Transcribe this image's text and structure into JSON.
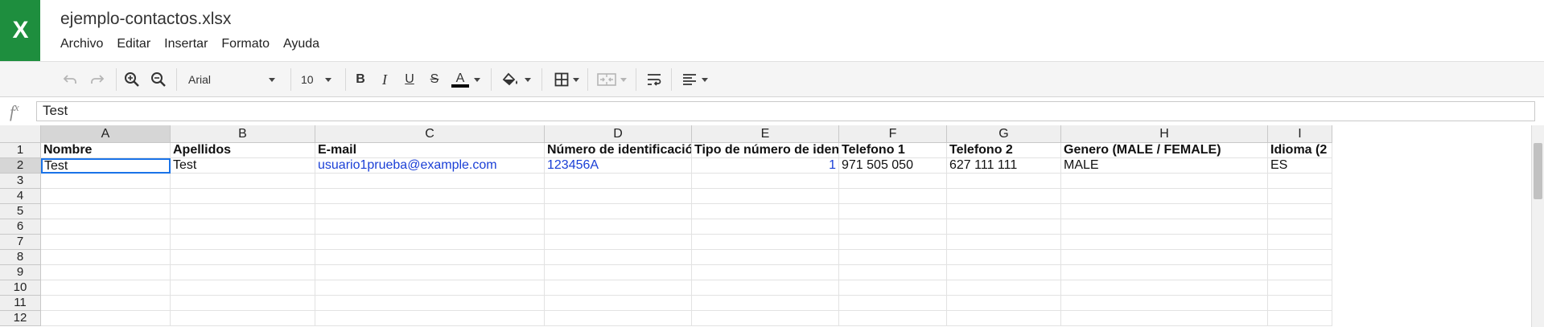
{
  "app": {
    "logo_letter": "X",
    "document_title": "ejemplo-contactos.xlsx",
    "menu": [
      "Archivo",
      "Editar",
      "Insertar",
      "Formato",
      "Ayuda"
    ]
  },
  "toolbar": {
    "font_name": "Arial",
    "font_size": "10",
    "text_color": "#000000",
    "icons": [
      "undo-icon",
      "redo-icon",
      "zoom-in-icon",
      "zoom-out-icon",
      "bold-icon",
      "italic-icon",
      "underline-icon",
      "strikethrough-icon",
      "text-color-icon",
      "fill-color-icon",
      "borders-icon",
      "merge-cells-icon",
      "wrap-text-icon",
      "align-icon"
    ]
  },
  "formula_bar": {
    "fx_label": "f",
    "fx_sup": "x",
    "value": "Test"
  },
  "sheet": {
    "columns": [
      "A",
      "B",
      "C",
      "D",
      "E",
      "F",
      "G",
      "H",
      "I"
    ],
    "rows": [
      "1",
      "2",
      "3",
      "4",
      "5",
      "6",
      "7",
      "8",
      "9",
      "10",
      "11",
      "12"
    ],
    "selected_column": "A",
    "selected_row": "2",
    "header_row": [
      "Nombre",
      "Apellidos",
      "E-mail",
      "Número de identificación (D",
      "Tipo de número de identific",
      "Telefono 1",
      "Telefono 2",
      "Genero (MALE / FEMALE)",
      "Idioma (2"
    ],
    "data_row": [
      "Test",
      "Test",
      "usuario1prueba@example.com",
      "123456A",
      "1",
      "971 505 050",
      "627 111 111",
      "MALE",
      "ES"
    ]
  },
  "colors": {
    "brand": "#1e8e3e",
    "selection": "#1a73e8",
    "link_text": "#1a3fd6"
  }
}
